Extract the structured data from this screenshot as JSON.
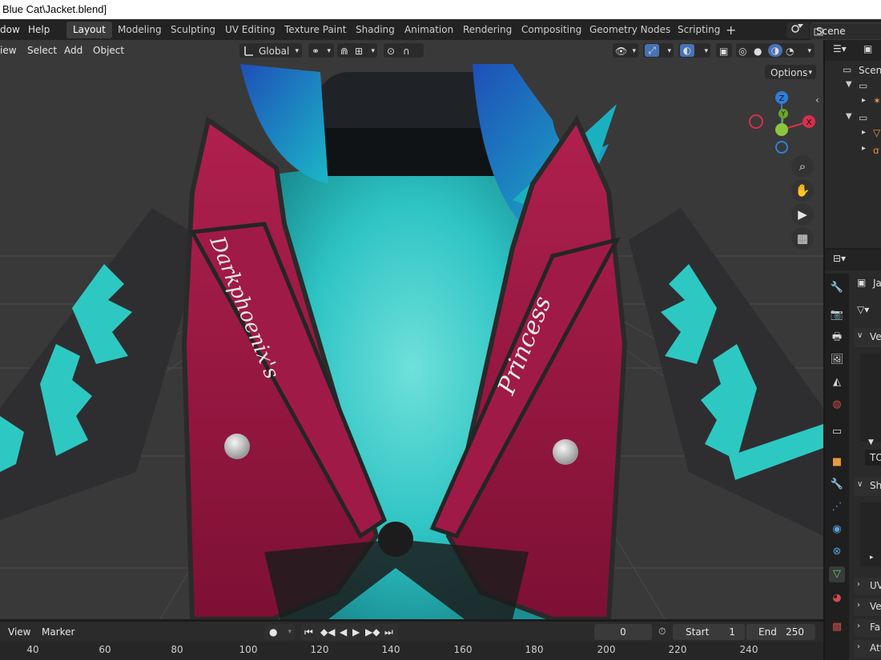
{
  "window": {
    "title": "Blue Cat\\Jacket.blend]"
  },
  "menus": {
    "window": "dow",
    "help": "Help"
  },
  "workspaces": [
    "Layout",
    "Modeling",
    "Sculpting",
    "UV Editing",
    "Texture Paint",
    "Shading",
    "Animation",
    "Rendering",
    "Compositing",
    "Geometry Nodes",
    "Scripting"
  ],
  "workspace_add": "+",
  "scene": {
    "label": "Scene"
  },
  "viewport_header": {
    "view": "iew",
    "select": "Select",
    "add": "Add",
    "object": "Object",
    "orientation": "Global",
    "options": "Options"
  },
  "jacket_text": {
    "left": "Darkphoenix's",
    "right": "Princess"
  },
  "gizmo": {
    "z": "Z",
    "y": "Y",
    "x": "X"
  },
  "outliner": {
    "scene_label": "Scene"
  },
  "properties": {
    "object_name": "Ja",
    "section1": "Ve",
    "section2": "Sh",
    "section3": "UV",
    "section4": "Ve",
    "section5": "Fac",
    "section6": "Att",
    "field_value": "TO"
  },
  "timeline": {
    "view": "View",
    "marker": "Marker",
    "current_frame": "0",
    "start_label": "Start",
    "start_value": "1",
    "end_label": "End",
    "end_value": "250",
    "ticks": [
      "40",
      "60",
      "80",
      "100",
      "120",
      "140",
      "160",
      "180",
      "200",
      "220",
      "240"
    ]
  },
  "colors": {
    "accent_blue": "#4772b3",
    "viewport_bg": "#393939",
    "jacket_red": "#9c1744",
    "skin_cyan": "#2fc8c8"
  }
}
